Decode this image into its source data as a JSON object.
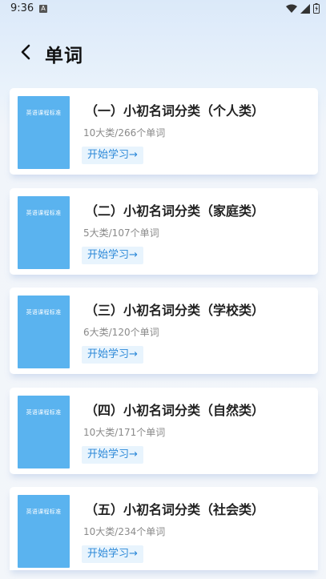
{
  "status": {
    "time": "9:36",
    "notif": "A"
  },
  "header": {
    "title": "单词"
  },
  "books": [
    {
      "title": "（一）小初名词分类（个人类）",
      "meta": "10大类/266个单词",
      "action": "开始学习→"
    },
    {
      "title": "（二）小初名词分类（家庭类）",
      "meta": "5大类/107个单词",
      "action": "开始学习→"
    },
    {
      "title": "（三）小初名词分类（学校类）",
      "meta": "6大类/120个单词",
      "action": "开始学习→"
    },
    {
      "title": "（四）小初名词分类（自然类）",
      "meta": "10大类/171个单词",
      "action": "开始学习→"
    },
    {
      "title": "（五）小初名词分类（社会类）",
      "meta": "10大类/234个单词",
      "action": "开始学习→"
    }
  ],
  "cover": {
    "title": "英语课程标准"
  },
  "colors": {
    "cover": "#5ab3ef",
    "accent": "#2b88d8",
    "button_bg": "#e8f4fd"
  }
}
